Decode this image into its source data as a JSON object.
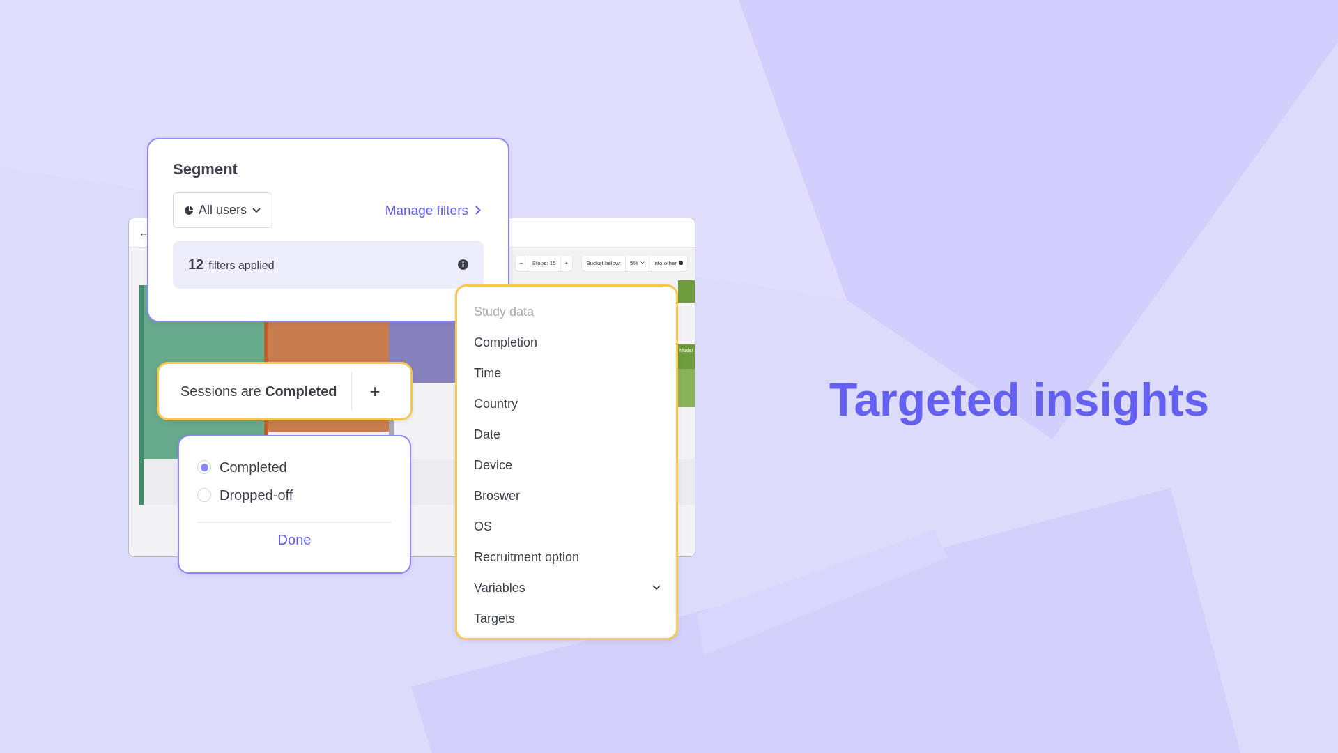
{
  "background_window": {
    "back_arrow": "←",
    "toolbar": {
      "minus": "−",
      "steps": "Steps: 15",
      "plus": "+",
      "bucket_label": "Bucket below:",
      "bucket_value": "5%",
      "into_other": "into other"
    },
    "chart_label": "Modal"
  },
  "segment": {
    "title": "Segment",
    "dropdown_value": "All users",
    "manage_link": "Manage filters",
    "filters_count": "12",
    "filters_label": "filters applied"
  },
  "condition": {
    "text": "Sessions are **Completed**",
    "add": "+"
  },
  "status_options": [
    {
      "label": "Completed",
      "selected": true
    },
    {
      "label": "Dropped-off",
      "selected": false
    }
  ],
  "done": "Done",
  "menu": {
    "heading": "Study data",
    "items": [
      {
        "label": "Completion",
        "expandable": false
      },
      {
        "label": "Time",
        "expandable": false
      },
      {
        "label": "Country",
        "expandable": false
      },
      {
        "label": "Date",
        "expandable": false
      },
      {
        "label": "Device",
        "expandable": false
      },
      {
        "label": "Broswer",
        "expandable": false
      },
      {
        "label": "OS",
        "expandable": false
      },
      {
        "label": "Recruitment option",
        "expandable": false
      },
      {
        "label": "Variables",
        "expandable": true
      },
      {
        "label": "Targets",
        "expandable": false
      }
    ]
  },
  "headline": "Targeted insights"
}
